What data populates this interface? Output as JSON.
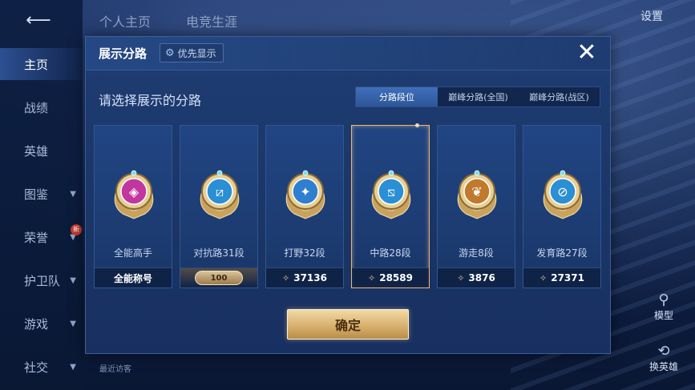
{
  "sidebar": {
    "items": [
      {
        "label": "主页",
        "active": true,
        "has_chevron": false
      },
      {
        "label": "战绩",
        "active": false,
        "has_chevron": false
      },
      {
        "label": "英雄",
        "active": false,
        "has_chevron": false
      },
      {
        "label": "图鉴",
        "active": false,
        "has_chevron": true
      },
      {
        "label": "荣誉",
        "active": false,
        "has_chevron": true
      },
      {
        "label": "护卫队",
        "active": false,
        "has_chevron": true
      },
      {
        "label": "游戏",
        "active": false,
        "has_chevron": true
      },
      {
        "label": "社交",
        "active": false,
        "has_chevron": true
      }
    ],
    "new_badge": "新"
  },
  "topnav": {
    "tab_home": "个人主页",
    "tab_career": "电竞生涯",
    "settings": "设置"
  },
  "right_panel": {
    "model": "模型",
    "change_hero": "换英雄"
  },
  "footer": {
    "recent_visitors": "最近访客"
  },
  "modal": {
    "title": "展示分路",
    "priority_button": "优先显示",
    "close_icon": "close-icon",
    "subtitle": "请选择展示的分路",
    "tabs": [
      {
        "label": "分路段位",
        "active": true
      },
      {
        "label": "巅峰分路(全国)",
        "active": false
      },
      {
        "label": "巅峰分路(战区)",
        "active": false
      }
    ],
    "cards": [
      {
        "label": "全能高手",
        "footer": "全能称号",
        "footer_type": "text",
        "selected": false,
        "badge_color": "#c2369f"
      },
      {
        "label": "对抗路31段",
        "footer": "100",
        "footer_type": "plate",
        "selected": false,
        "badge_color": "#2a8fd4"
      },
      {
        "label": "打野32段",
        "footer": "37136",
        "footer_type": "points",
        "selected": false,
        "badge_color": "#2f7fd0"
      },
      {
        "label": "中路28段",
        "footer": "28589",
        "footer_type": "points",
        "selected": true,
        "badge_color": "#2a8fd4"
      },
      {
        "label": "游走8段",
        "footer": "3876",
        "footer_type": "points",
        "selected": false,
        "badge_color": "#c17a2b"
      },
      {
        "label": "发育路27段",
        "footer": "27371",
        "footer_type": "points",
        "selected": false,
        "badge_color": "#2a8fd4"
      }
    ],
    "confirm_button": "确定"
  },
  "colors": {
    "accent_gold": "#d8b06f",
    "modal_bg": "#1f3d74",
    "tab_active": "#3f6fba",
    "selected_border": "#e8b77c"
  }
}
